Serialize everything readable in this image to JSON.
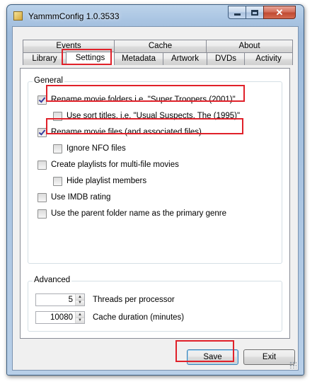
{
  "window": {
    "title": "YammmConfig 1.0.3533",
    "icon": "app-icon",
    "controls": {
      "minimize": "minimize-icon",
      "maximize": "maximize-icon",
      "close": "✕"
    }
  },
  "tabs": {
    "row1": [
      "Events",
      "Cache",
      "About"
    ],
    "row2": [
      "Library",
      "Settings",
      "Metadata",
      "Artwork",
      "DVDs",
      "Activity"
    ],
    "active": "Settings"
  },
  "general": {
    "title": "General",
    "options": [
      {
        "label": "Rename movie folders i.e. \"Super Troopers (2001)\"",
        "checked": true
      },
      {
        "label": "Use sort titles, i.e. \"Usual Suspects, The (1995)\"",
        "checked": false
      },
      {
        "label": "Rename movie files (and associated files)",
        "checked": true
      },
      {
        "label": "Ignore NFO files",
        "checked": false
      },
      {
        "label": "Create playlists for multi-file movies",
        "checked": false
      },
      {
        "label": "Hide playlist members",
        "checked": false
      },
      {
        "label": "Use IMDB rating",
        "checked": false
      },
      {
        "label": "Use the parent folder name as the primary genre",
        "checked": false
      }
    ]
  },
  "advanced": {
    "title": "Advanced",
    "threads": {
      "value": "5",
      "label": "Threads per processor"
    },
    "cache": {
      "value": "10080",
      "label": "Cache duration (minutes)"
    }
  },
  "buttons": {
    "save": "Save",
    "exit": "Exit"
  },
  "colors": {
    "highlight": "#e0212a",
    "titlebar": "#a9c4e2",
    "checkmark": "#3a3f9c"
  }
}
